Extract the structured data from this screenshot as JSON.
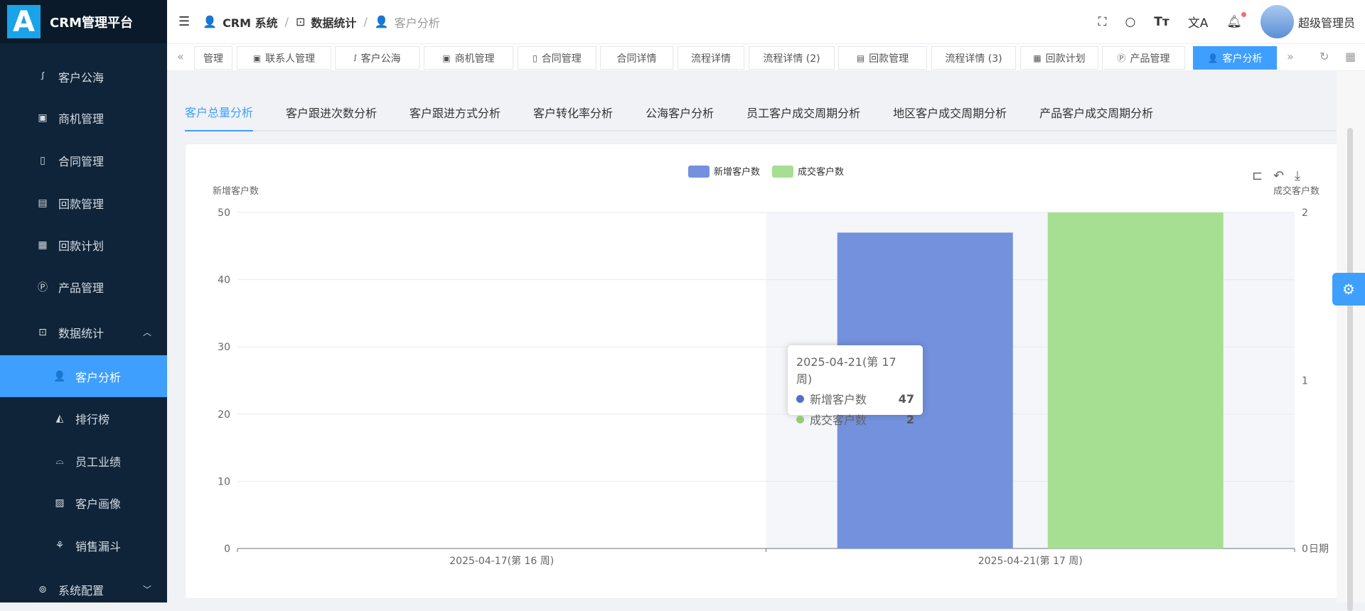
{
  "app": {
    "logo_letter": "A",
    "title": "CRM管理平台"
  },
  "sidebar": {
    "items": [
      {
        "label": "客户公海",
        "icon": "sea-icon",
        "glyph": "ꭍ"
      },
      {
        "label": "商机管理",
        "icon": "bus-icon",
        "glyph": "▣"
      },
      {
        "label": "合同管理",
        "icon": "contract-icon",
        "glyph": "▯"
      },
      {
        "label": "回款管理",
        "icon": "payment-icon",
        "glyph": "▤"
      },
      {
        "label": "回款计划",
        "icon": "money-icon",
        "glyph": "▦"
      },
      {
        "label": "产品管理",
        "icon": "product-icon",
        "glyph": "Ⓟ"
      },
      {
        "label": "数据统计",
        "icon": "presentation-icon",
        "glyph": "⊡",
        "chevron": "︿"
      },
      {
        "label": "客户分析",
        "icon": "user-icon",
        "glyph": "👤"
      },
      {
        "label": "排行榜",
        "icon": "area-chart-icon",
        "glyph": "◭"
      },
      {
        "label": "员工业绩",
        "icon": "bell-icon",
        "glyph": "⌓"
      },
      {
        "label": "客户画像",
        "icon": "image-icon",
        "glyph": "▨"
      },
      {
        "label": "销售漏斗",
        "icon": "funnel-icon",
        "glyph": "⚘"
      },
      {
        "label": "系统配置",
        "icon": "config-icon",
        "glyph": "⊚",
        "chevron": "﹀"
      }
    ]
  },
  "header": {
    "breadcrumb": [
      "CRM 系统",
      "数据统计",
      "客户分析"
    ],
    "separator": "/",
    "user": "超级管理员"
  },
  "tabs": [
    "管理",
    "联系人管理",
    "客户公海",
    "商机管理",
    "合同管理",
    "合同详情",
    "流程详情",
    "流程详情 (2)",
    "回款管理",
    "流程详情 (3)",
    "回款计划",
    "产品管理",
    "客户分析"
  ],
  "subtabs": [
    "客户总量分析",
    "客户跟进次数分析",
    "客户跟进方式分析",
    "客户转化率分析",
    "公海客户分析",
    "员工客户成交周期分析",
    "地区客户成交周期分析",
    "产品客户成交周期分析"
  ],
  "chart_data": {
    "type": "bar",
    "categories": [
      "2025-04-17(第 16 周)",
      "2025-04-21(第 17 周)"
    ],
    "series": [
      {
        "name": "新增客户数",
        "values": [
          0,
          47
        ],
        "color": "#7491dd",
        "axis": "left"
      },
      {
        "name": "成交客户数",
        "values": [
          0,
          2
        ],
        "color": "#a6df92",
        "axis": "right"
      }
    ],
    "ylabel_left": "新增客户数",
    "ylabel_right": "成交客户数",
    "xlabel": "日期",
    "ylim_left": [
      0,
      50
    ],
    "yticks_left": [
      0,
      10,
      20,
      30,
      40,
      50
    ],
    "ylim_right": [
      0,
      2
    ],
    "yticks_right": [
      0,
      1,
      2
    ],
    "legend": "top-center",
    "tooltip": {
      "title": "2025-04-21(第 17 周)",
      "rows": [
        {
          "name": "新增客户数",
          "value": "47"
        },
        {
          "name": "成交客户数",
          "value": "2"
        }
      ]
    }
  }
}
